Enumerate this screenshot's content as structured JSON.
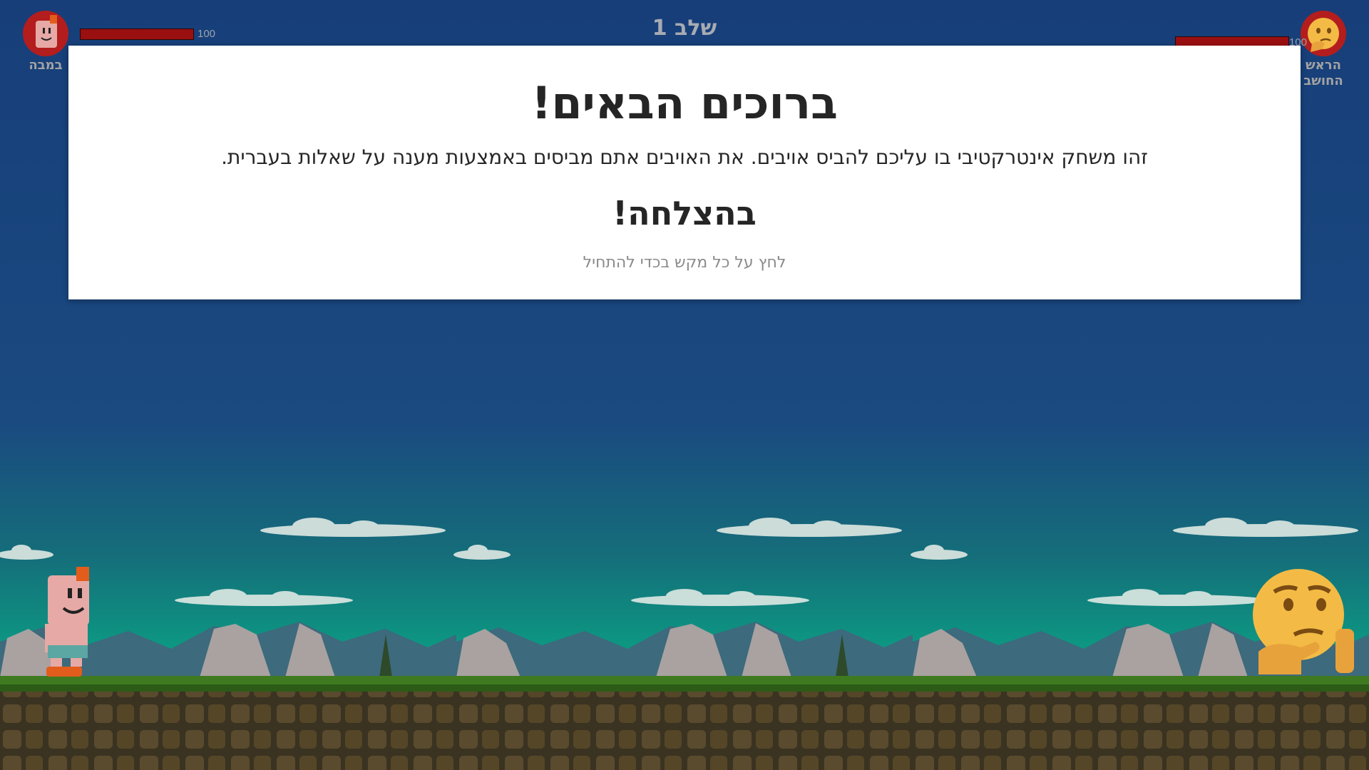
{
  "level": {
    "title": "שלב 1"
  },
  "player": {
    "name": "במבה",
    "hp": 100,
    "hp_label": "100",
    "avatar_icon": "bamba-character-icon"
  },
  "enemy": {
    "name_line1": "הראש",
    "name_line2": "החושב",
    "hp": 100,
    "hp_label": "100",
    "avatar_icon": "thinking-face-icon"
  },
  "modal": {
    "title": "ברוכים הבאים!",
    "description": "זהו משחק אינטרקטיבי בו עליכם להביס אויבים. את האויבים אתם מביסים באמצעות מענה על שאלות בעברית.",
    "good_luck": "בהצלחה!",
    "hint": "לחץ על כל מקש בכדי להתחיל"
  },
  "colors": {
    "sky_top": "#173e79",
    "hp_fill": "#9a0f10",
    "avatar_bg": "#b41d1d",
    "hud_text": "#a3a3a3"
  }
}
